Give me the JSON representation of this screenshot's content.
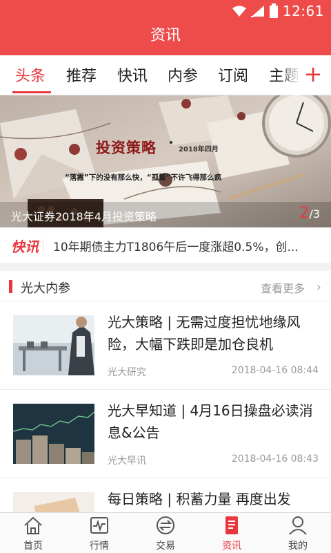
{
  "status_bar": {
    "time": "12:61"
  },
  "header": {
    "title": "资讯"
  },
  "tabs": [
    {
      "label": "头条",
      "active": true
    },
    {
      "label": "推荐"
    },
    {
      "label": "快讯"
    },
    {
      "label": "内参"
    },
    {
      "label": "订阅"
    },
    {
      "label": "主题"
    }
  ],
  "tabs_add_icon": "+",
  "banner": {
    "title": "投资策略",
    "date": "2018年四月",
    "quote": "“落霞”下的没有那么快，“孤鹜”不许飞得那么疯",
    "caption": "光大证券2018年4月投资策略",
    "pager_current": "2",
    "pager_total": "/3"
  },
  "flash": {
    "label": "快讯",
    "text": "10年期债主力T1806午后一度涨超0.5%，创..."
  },
  "section": {
    "title": "光大内参",
    "more": "查看更多",
    "chevron": "›"
  },
  "articles": [
    {
      "title": "光大策略 | 无需过度担忧地缘风险，大幅下跌即是加仓良机",
      "source": "光大研究",
      "time": "2018-04-16 08:44"
    },
    {
      "title": "光大早知道 | 4月16日操盘必读消息&公告",
      "source": "光大早讯",
      "time": "2018-04-16 08:43"
    },
    {
      "title": "每日策略 | 积蓄力量 再度出发",
      "source": "",
      "time": ""
    }
  ],
  "bottom_nav": [
    {
      "label": "首页",
      "icon": "home-icon"
    },
    {
      "label": "行情",
      "icon": "market-chart-icon"
    },
    {
      "label": "交易",
      "icon": "exchange-icon"
    },
    {
      "label": "资讯",
      "icon": "news-icon",
      "active": true
    },
    {
      "label": "我的",
      "icon": "user-icon"
    }
  ],
  "colors": {
    "brand_red": "#ee4b4b",
    "accent_red": "#e8383d"
  }
}
